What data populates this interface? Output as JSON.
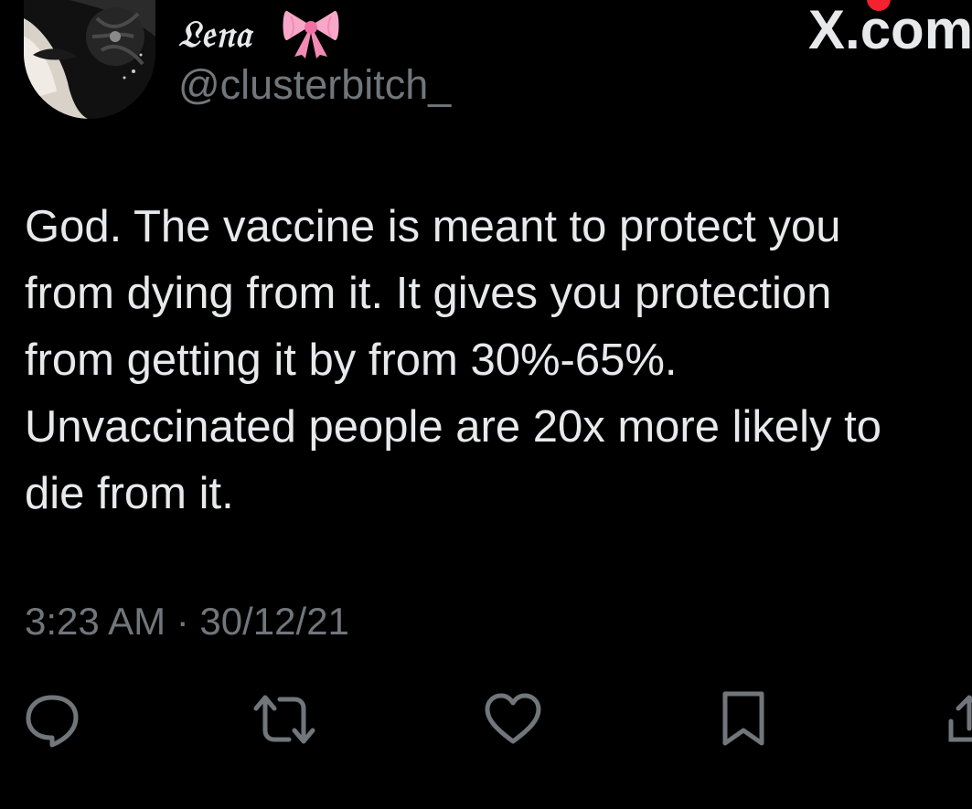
{
  "author": {
    "display_name": "𝔏𝔢𝔫𝔞",
    "handle": "@clusterbitch_",
    "avatar_icon": "avatar-portrait",
    "badge_icon": "pink-bow-icon"
  },
  "watermark": "X.com",
  "tweet": {
    "text": "God. The vaccine is meant to protect you\nfrom dying from it. It gives you protection\nfrom getting it by from 30%-65%.\nUnvaccinated people are 20x more likely to\ndie from it."
  },
  "timestamp": "3:23 AM · 30/12/21",
  "actions": [
    {
      "icon": "reply-icon"
    },
    {
      "icon": "retweet-icon"
    },
    {
      "icon": "like-icon"
    },
    {
      "icon": "bookmark-icon"
    },
    {
      "icon": "share-icon"
    }
  ],
  "colors": {
    "background": "#000000",
    "text_primary": "#e7e9ea",
    "text_secondary": "#71767b",
    "bow_pink": "#f7a8c8",
    "notification": "#f4212e"
  }
}
